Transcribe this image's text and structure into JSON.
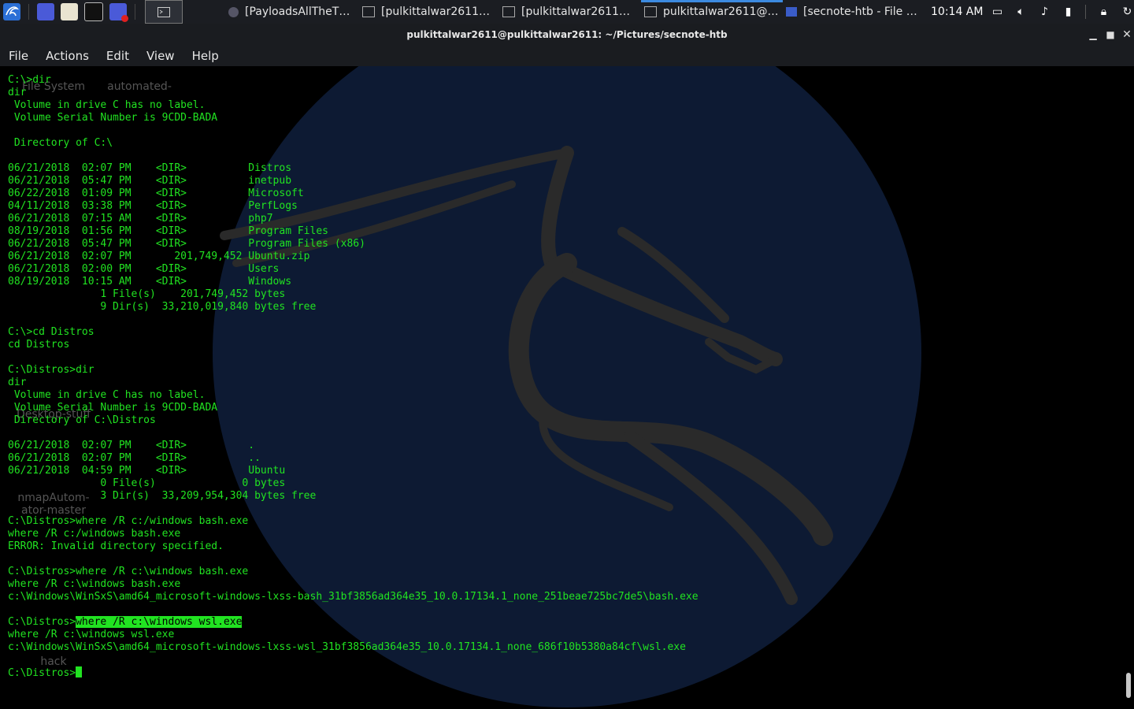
{
  "panel": {
    "launcher_icon": "kali-dragon-icon",
    "quick_launch": [
      "app-launcher-icon",
      "file-manager-icon",
      "terminal-icon",
      "screenshot-icon"
    ],
    "tasks": [
      {
        "label": "[PayloadsAllTheThin...",
        "icon": "browser-icon"
      },
      {
        "label": "[pulkittalwar2611@p...",
        "icon": "terminal-icon"
      },
      {
        "label": "[pulkittalwar2611@p...",
        "icon": "terminal-icon"
      },
      {
        "label": "pulkittalwar2611@pu...",
        "icon": "terminal-icon"
      },
      {
        "label": "[secnote-htb - File M...",
        "icon": "folder-icon"
      }
    ],
    "clock": "10:14 AM",
    "tray": [
      "display-icon",
      "volume-icon",
      "notifications-icon",
      "battery-icon",
      "lock-icon",
      "logout-icon"
    ]
  },
  "window": {
    "title": "pulkittalwar2611@pulkittalwar2611: ~/Pictures/secnote-htb"
  },
  "menubar": [
    "File",
    "Actions",
    "Edit",
    "View",
    "Help"
  ],
  "desktop": {
    "icons": [
      {
        "label": "File System"
      },
      {
        "label": "automated-"
      },
      {
        "label": "Desktop-stuff"
      },
      {
        "label": "nmapAutom-"
      },
      {
        "label": "ator-master"
      },
      {
        "label": "hack"
      }
    ]
  },
  "terminal": {
    "lines": [
      {
        "text": "C:\\>dir"
      },
      {
        "text": "dir"
      },
      {
        "text": " Volume in drive C has no label."
      },
      {
        "text": " Volume Serial Number is 9CDD-BADA"
      },
      {
        "text": ""
      },
      {
        "text": " Directory of C:\\"
      },
      {
        "text": ""
      },
      {
        "text": "06/21/2018  02:07 PM    <DIR>          Distros"
      },
      {
        "text": "06/21/2018  05:47 PM    <DIR>          inetpub"
      },
      {
        "text": "06/22/2018  01:09 PM    <DIR>          Microsoft"
      },
      {
        "text": "04/11/2018  03:38 PM    <DIR>          PerfLogs"
      },
      {
        "text": "06/21/2018  07:15 AM    <DIR>          php7"
      },
      {
        "text": "08/19/2018  01:56 PM    <DIR>          Program Files"
      },
      {
        "text": "06/21/2018  05:47 PM    <DIR>          Program Files (x86)"
      },
      {
        "text": "06/21/2018  02:07 PM       201,749,452 Ubuntu.zip"
      },
      {
        "text": "06/21/2018  02:00 PM    <DIR>          Users"
      },
      {
        "text": "08/19/2018  10:15 AM    <DIR>          Windows"
      },
      {
        "text": "               1 File(s)    201,749,452 bytes"
      },
      {
        "text": "               9 Dir(s)  33,210,019,840 bytes free"
      },
      {
        "text": ""
      },
      {
        "text": "C:\\>cd Distros"
      },
      {
        "text": "cd Distros"
      },
      {
        "text": ""
      },
      {
        "text": "C:\\Distros>dir"
      },
      {
        "text": "dir"
      },
      {
        "text": " Volume in drive C has no label."
      },
      {
        "text": " Volume Serial Number is 9CDD-BADA"
      },
      {
        "text": " Directory of C:\\Distros"
      },
      {
        "text": ""
      },
      {
        "text": "06/21/2018  02:07 PM    <DIR>          ."
      },
      {
        "text": "06/21/2018  02:07 PM    <DIR>          .."
      },
      {
        "text": "06/21/2018  04:59 PM    <DIR>          Ubuntu"
      },
      {
        "text": "               0 File(s)              0 bytes"
      },
      {
        "text": "               3 Dir(s)  33,209,954,304 bytes free"
      },
      {
        "text": ""
      },
      {
        "text": "C:\\Distros>where /R c:/windows bash.exe"
      },
      {
        "text": "where /R c:/windows bash.exe"
      },
      {
        "text": "ERROR: Invalid directory specified."
      },
      {
        "text": ""
      },
      {
        "text": "C:\\Distros>where /R c:\\windows bash.exe"
      },
      {
        "text": "where /R c:\\windows bash.exe"
      },
      {
        "text": "c:\\Windows\\WinSxS\\amd64_microsoft-windows-lxss-bash_31bf3856ad364e35_10.0.17134.1_none_251beae725bc7de5\\bash.exe"
      },
      {
        "text": ""
      },
      {
        "text": "C:\\Distros>",
        "highlight": "where /R c:\\windows wsl.exe"
      },
      {
        "text": "where /R c:\\windows wsl.exe"
      },
      {
        "text": "c:\\Windows\\WinSxS\\amd64_microsoft-windows-lxss-wsl_31bf3856ad364e35_10.0.17134.1_none_686f10b5380a84cf\\wsl.exe"
      },
      {
        "text": ""
      },
      {
        "text": "C:\\Distros>",
        "cursor": true
      }
    ]
  },
  "colors": {
    "terminal_text": "#21e321",
    "terminal_bg": "#000000",
    "panel_bg": "#1b1d22",
    "active_task_indicator": "#3c8ae0",
    "wallpaper_circle": "#0d1a33",
    "dragon": "#2a2a2a"
  }
}
